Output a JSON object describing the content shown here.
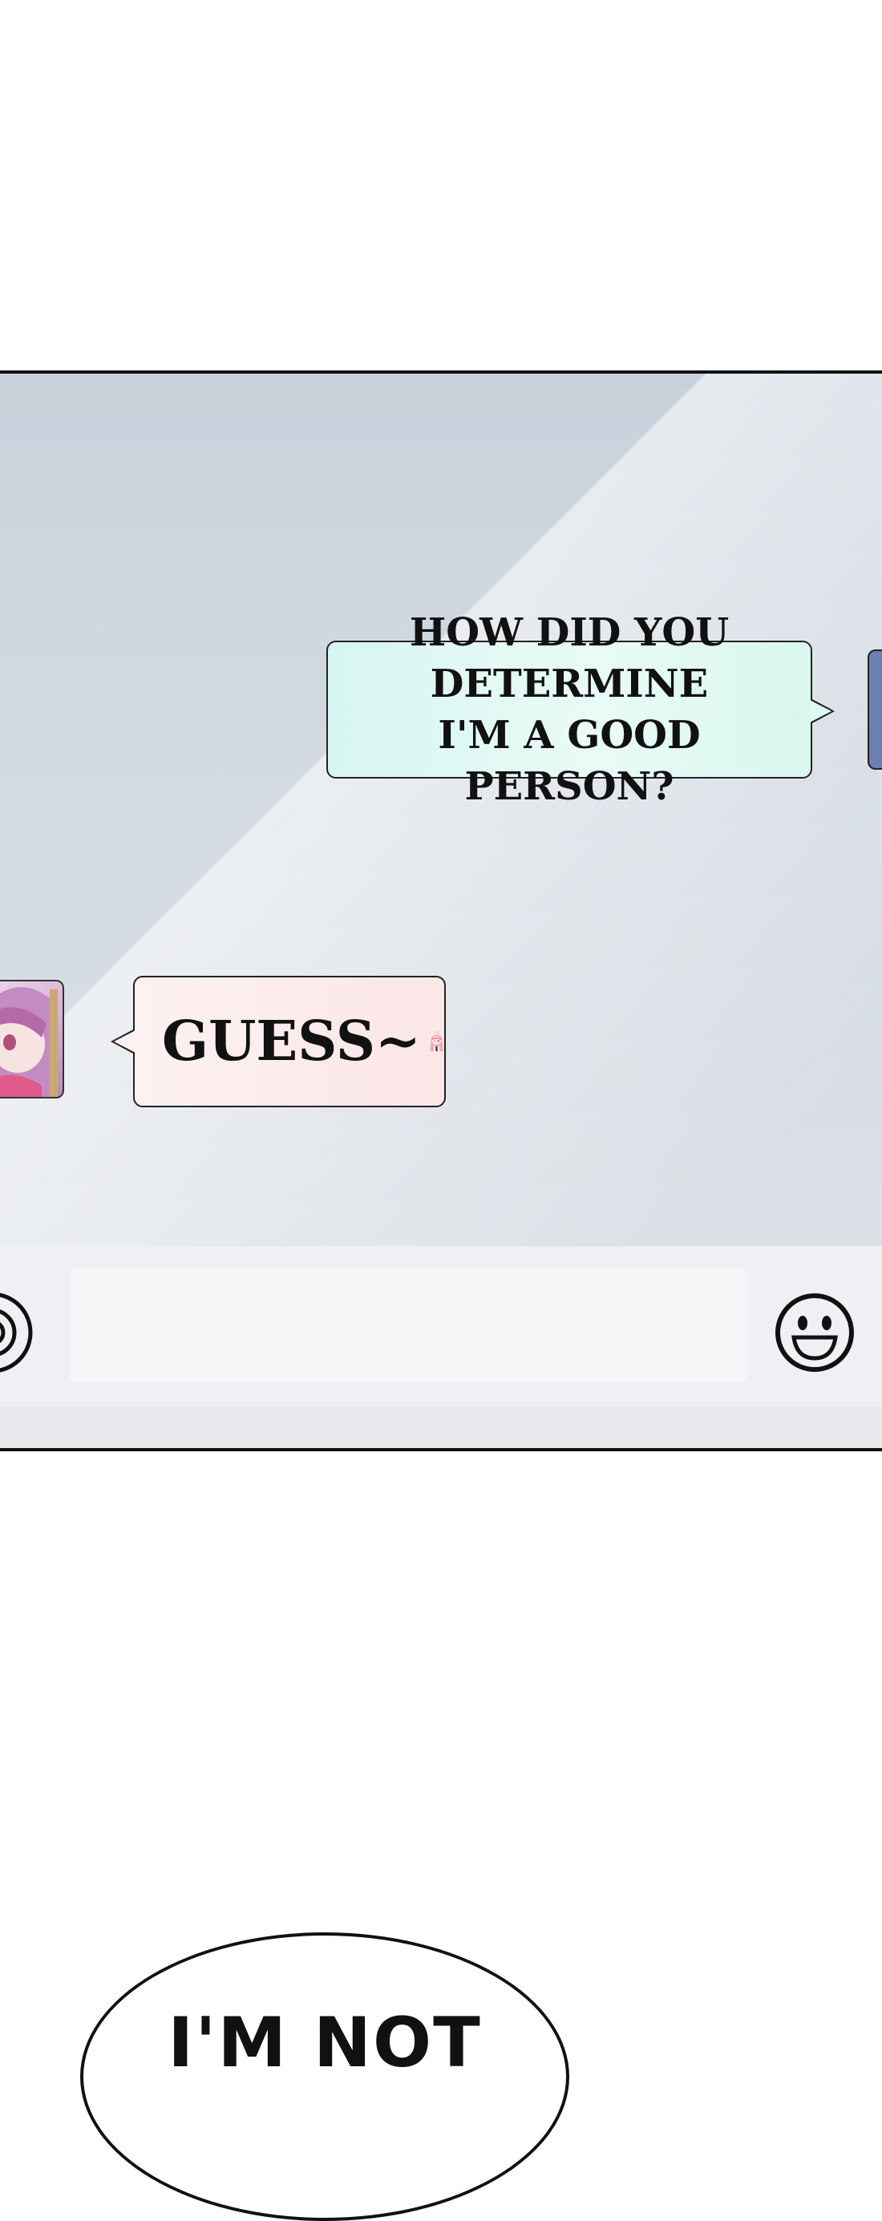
{
  "chat": {
    "message_right": {
      "line1": "HOW DID YOU DETERMINE",
      "line2": "I'M A GOOD PERSON?"
    },
    "message_left": {
      "text": "GUESS~"
    },
    "input_placeholder": ""
  },
  "icons": {
    "voice": "voice-icon",
    "emoji": "emoji-smile-icon",
    "sticker": "chibi-wink-sticker"
  },
  "balloon": {
    "text": "I'M NOT"
  },
  "colors": {
    "right_bubble": "#e0f8f2",
    "left_bubble": "#fdf1f1",
    "outline": "#111111"
  }
}
